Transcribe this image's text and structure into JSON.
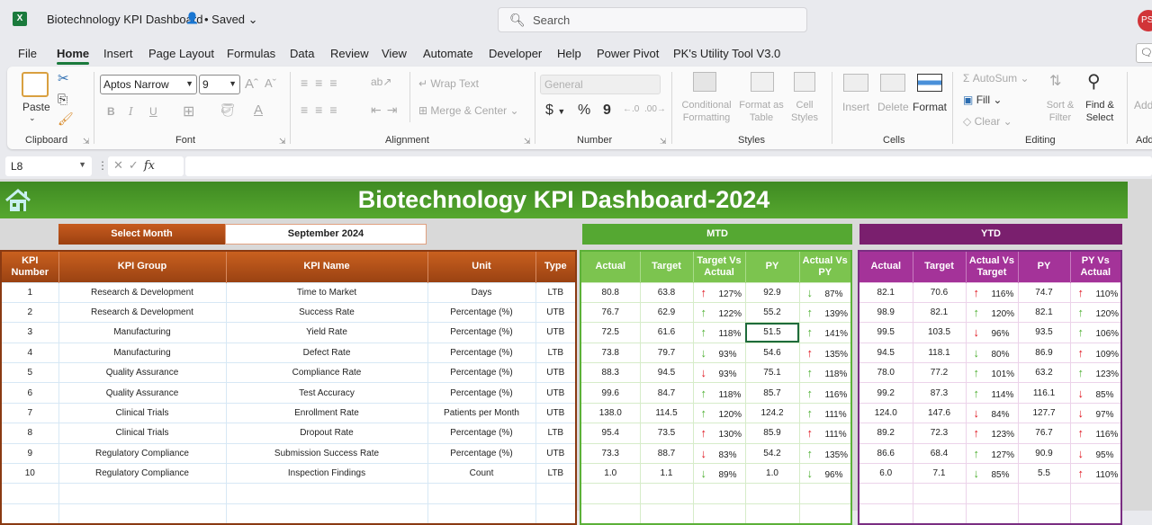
{
  "app": {
    "title": "Biotechnology KPI Dashboard",
    "saved_status": "• Saved",
    "search_placeholder": "Search",
    "avatar_initials": "PS"
  },
  "menu": {
    "tabs": [
      "File",
      "Home",
      "Insert",
      "Page Layout",
      "Formulas",
      "Data",
      "Review",
      "View",
      "Automate",
      "Developer",
      "Help",
      "Power Pivot",
      "PK's Utility Tool V3.0"
    ],
    "active": "Home"
  },
  "ribbon": {
    "clipboard": {
      "label": "Clipboard",
      "paste": "Paste"
    },
    "font": {
      "label": "Font",
      "font_name": "Aptos Narrow",
      "font_size": "9",
      "bold": "B",
      "italic": "I",
      "underline": "U"
    },
    "alignment": {
      "label": "Alignment",
      "wrap_text": "Wrap Text",
      "merge_center": "Merge & Center"
    },
    "number": {
      "label": "Number",
      "format": "General",
      "currency": "$",
      "percent": "%",
      "comma": "9"
    },
    "styles": {
      "label": "Styles",
      "conditional_formatting": "Conditional Formatting",
      "format_as_table": "Format as Table",
      "cell_styles": "Cell Styles"
    },
    "cells": {
      "label": "Cells",
      "insert": "Insert",
      "delete": "Delete",
      "format": "Format"
    },
    "editing": {
      "label": "Editing",
      "autosum": "AutoSum",
      "fill": "Fill",
      "clear": "Clear",
      "sort_filter": "Sort & Filter",
      "find_select": "Find & Select"
    },
    "addins": {
      "label": "Add",
      "addins": "Add"
    }
  },
  "formula_bar": {
    "name_box": "L8",
    "fx": "fx",
    "formula": ""
  },
  "dashboard": {
    "title": "Biotechnology KPI Dashboard-2024",
    "select_month_label": "Select Month",
    "select_month_value": "September 2024",
    "mtd_label": "MTD",
    "ytd_label": "YTD",
    "info_headers": [
      "KPI Number",
      "KPI Group",
      "KPI Name",
      "Unit",
      "Type"
    ],
    "mtd_headers": [
      "Actual",
      "Target",
      "Target Vs Actual",
      "PY",
      "Actual Vs PY"
    ],
    "ytd_headers": [
      "Actual",
      "Target",
      "Actual Vs Target",
      "PY",
      "PY Vs Actual"
    ],
    "colors": {
      "green_arrow": "#4caf2f",
      "red_arrow": "#e0141e",
      "banner": "#4a9a28",
      "mtd": "#55a832",
      "ytd": "#7a1f6e",
      "info": "#b4501a"
    },
    "rows": [
      {
        "num": "1",
        "group": "Research & Development",
        "name": "Time to Market",
        "unit": "Days",
        "type": "LTB",
        "mtd": {
          "actual": "80.8",
          "target": "63.8",
          "tva": "127%",
          "tva_dir": "up",
          "tva_color": "red",
          "py": "92.9",
          "avp": "87%",
          "avp_dir": "down",
          "avp_color": "green"
        },
        "ytd": {
          "actual": "82.1",
          "target": "70.6",
          "avt": "116%",
          "avt_dir": "up",
          "avt_color": "red",
          "py": "74.7",
          "pva": "110%",
          "pva_dir": "up",
          "pva_color": "red"
        }
      },
      {
        "num": "2",
        "group": "Research & Development",
        "name": "Success Rate",
        "unit": "Percentage (%)",
        "type": "UTB",
        "mtd": {
          "actual": "76.7",
          "target": "62.9",
          "tva": "122%",
          "tva_dir": "up",
          "tva_color": "green",
          "py": "55.2",
          "avp": "139%",
          "avp_dir": "up",
          "avp_color": "green"
        },
        "ytd": {
          "actual": "98.9",
          "target": "82.1",
          "avt": "120%",
          "avt_dir": "up",
          "avt_color": "green",
          "py": "82.1",
          "pva": "120%",
          "pva_dir": "up",
          "pva_color": "green"
        }
      },
      {
        "num": "3",
        "group": "Manufacturing",
        "name": "Yield Rate",
        "unit": "Percentage (%)",
        "type": "UTB",
        "mtd": {
          "actual": "72.5",
          "target": "61.6",
          "tva": "118%",
          "tva_dir": "up",
          "tva_color": "green",
          "py": "51.5",
          "avp": "141%",
          "avp_dir": "up",
          "avp_color": "green"
        },
        "ytd": {
          "actual": "99.5",
          "target": "103.5",
          "avt": "96%",
          "avt_dir": "down",
          "avt_color": "red",
          "py": "93.5",
          "pva": "106%",
          "pva_dir": "up",
          "pva_color": "green"
        }
      },
      {
        "num": "4",
        "group": "Manufacturing",
        "name": "Defect Rate",
        "unit": "Percentage (%)",
        "type": "LTB",
        "mtd": {
          "actual": "73.8",
          "target": "79.7",
          "tva": "93%",
          "tva_dir": "down",
          "tva_color": "green",
          "py": "54.6",
          "avp": "135%",
          "avp_dir": "up",
          "avp_color": "red"
        },
        "ytd": {
          "actual": "94.5",
          "target": "118.1",
          "avt": "80%",
          "avt_dir": "down",
          "avt_color": "green",
          "py": "86.9",
          "pva": "109%",
          "pva_dir": "up",
          "pva_color": "red"
        }
      },
      {
        "num": "5",
        "group": "Quality Assurance",
        "name": "Compliance Rate",
        "unit": "Percentage (%)",
        "type": "UTB",
        "mtd": {
          "actual": "88.3",
          "target": "94.5",
          "tva": "93%",
          "tva_dir": "down",
          "tva_color": "red",
          "py": "75.1",
          "avp": "118%",
          "avp_dir": "up",
          "avp_color": "green"
        },
        "ytd": {
          "actual": "78.0",
          "target": "77.2",
          "avt": "101%",
          "avt_dir": "up",
          "avt_color": "green",
          "py": "63.2",
          "pva": "123%",
          "pva_dir": "up",
          "pva_color": "green"
        }
      },
      {
        "num": "6",
        "group": "Quality Assurance",
        "name": "Test Accuracy",
        "unit": "Percentage (%)",
        "type": "UTB",
        "mtd": {
          "actual": "99.6",
          "target": "84.7",
          "tva": "118%",
          "tva_dir": "up",
          "tva_color": "green",
          "py": "85.7",
          "avp": "116%",
          "avp_dir": "up",
          "avp_color": "green"
        },
        "ytd": {
          "actual": "99.2",
          "target": "87.3",
          "avt": "114%",
          "avt_dir": "up",
          "avt_color": "green",
          "py": "116.1",
          "pva": "85%",
          "pva_dir": "down",
          "pva_color": "red"
        }
      },
      {
        "num": "7",
        "group": "Clinical Trials",
        "name": "Enrollment Rate",
        "unit": "Patients per Month",
        "type": "UTB",
        "mtd": {
          "actual": "138.0",
          "target": "114.5",
          "tva": "120%",
          "tva_dir": "up",
          "tva_color": "green",
          "py": "124.2",
          "avp": "111%",
          "avp_dir": "up",
          "avp_color": "green"
        },
        "ytd": {
          "actual": "124.0",
          "target": "147.6",
          "avt": "84%",
          "avt_dir": "down",
          "avt_color": "red",
          "py": "127.7",
          "pva": "97%",
          "pva_dir": "down",
          "pva_color": "red"
        }
      },
      {
        "num": "8",
        "group": "Clinical Trials",
        "name": "Dropout Rate",
        "unit": "Percentage (%)",
        "type": "LTB",
        "mtd": {
          "actual": "95.4",
          "target": "73.5",
          "tva": "130%",
          "tva_dir": "up",
          "tva_color": "red",
          "py": "85.9",
          "avp": "111%",
          "avp_dir": "up",
          "avp_color": "red"
        },
        "ytd": {
          "actual": "89.2",
          "target": "72.3",
          "avt": "123%",
          "avt_dir": "up",
          "avt_color": "red",
          "py": "76.7",
          "pva": "116%",
          "pva_dir": "up",
          "pva_color": "red"
        }
      },
      {
        "num": "9",
        "group": "Regulatory Compliance",
        "name": "Submission Success Rate",
        "unit": "Percentage (%)",
        "type": "UTB",
        "mtd": {
          "actual": "73.3",
          "target": "88.7",
          "tva": "83%",
          "tva_dir": "down",
          "tva_color": "red",
          "py": "54.2",
          "avp": "135%",
          "avp_dir": "up",
          "avp_color": "green"
        },
        "ytd": {
          "actual": "86.6",
          "target": "68.4",
          "avt": "127%",
          "avt_dir": "up",
          "avt_color": "green",
          "py": "90.9",
          "pva": "95%",
          "pva_dir": "down",
          "pva_color": "red"
        }
      },
      {
        "num": "10",
        "group": "Regulatory Compliance",
        "name": "Inspection Findings",
        "unit": "Count",
        "type": "LTB",
        "mtd": {
          "actual": "1.0",
          "target": "1.1",
          "tva": "89%",
          "tva_dir": "down",
          "tva_color": "green",
          "py": "1.0",
          "avp": "96%",
          "avp_dir": "down",
          "avp_color": "green"
        },
        "ytd": {
          "actual": "6.0",
          "target": "7.1",
          "avt": "85%",
          "avt_dir": "down",
          "avt_color": "green",
          "py": "5.5",
          "pva": "110%",
          "pva_dir": "up",
          "pva_color": "red"
        }
      }
    ],
    "selected_cell": {
      "row": 3,
      "column": "mtd-py"
    }
  }
}
